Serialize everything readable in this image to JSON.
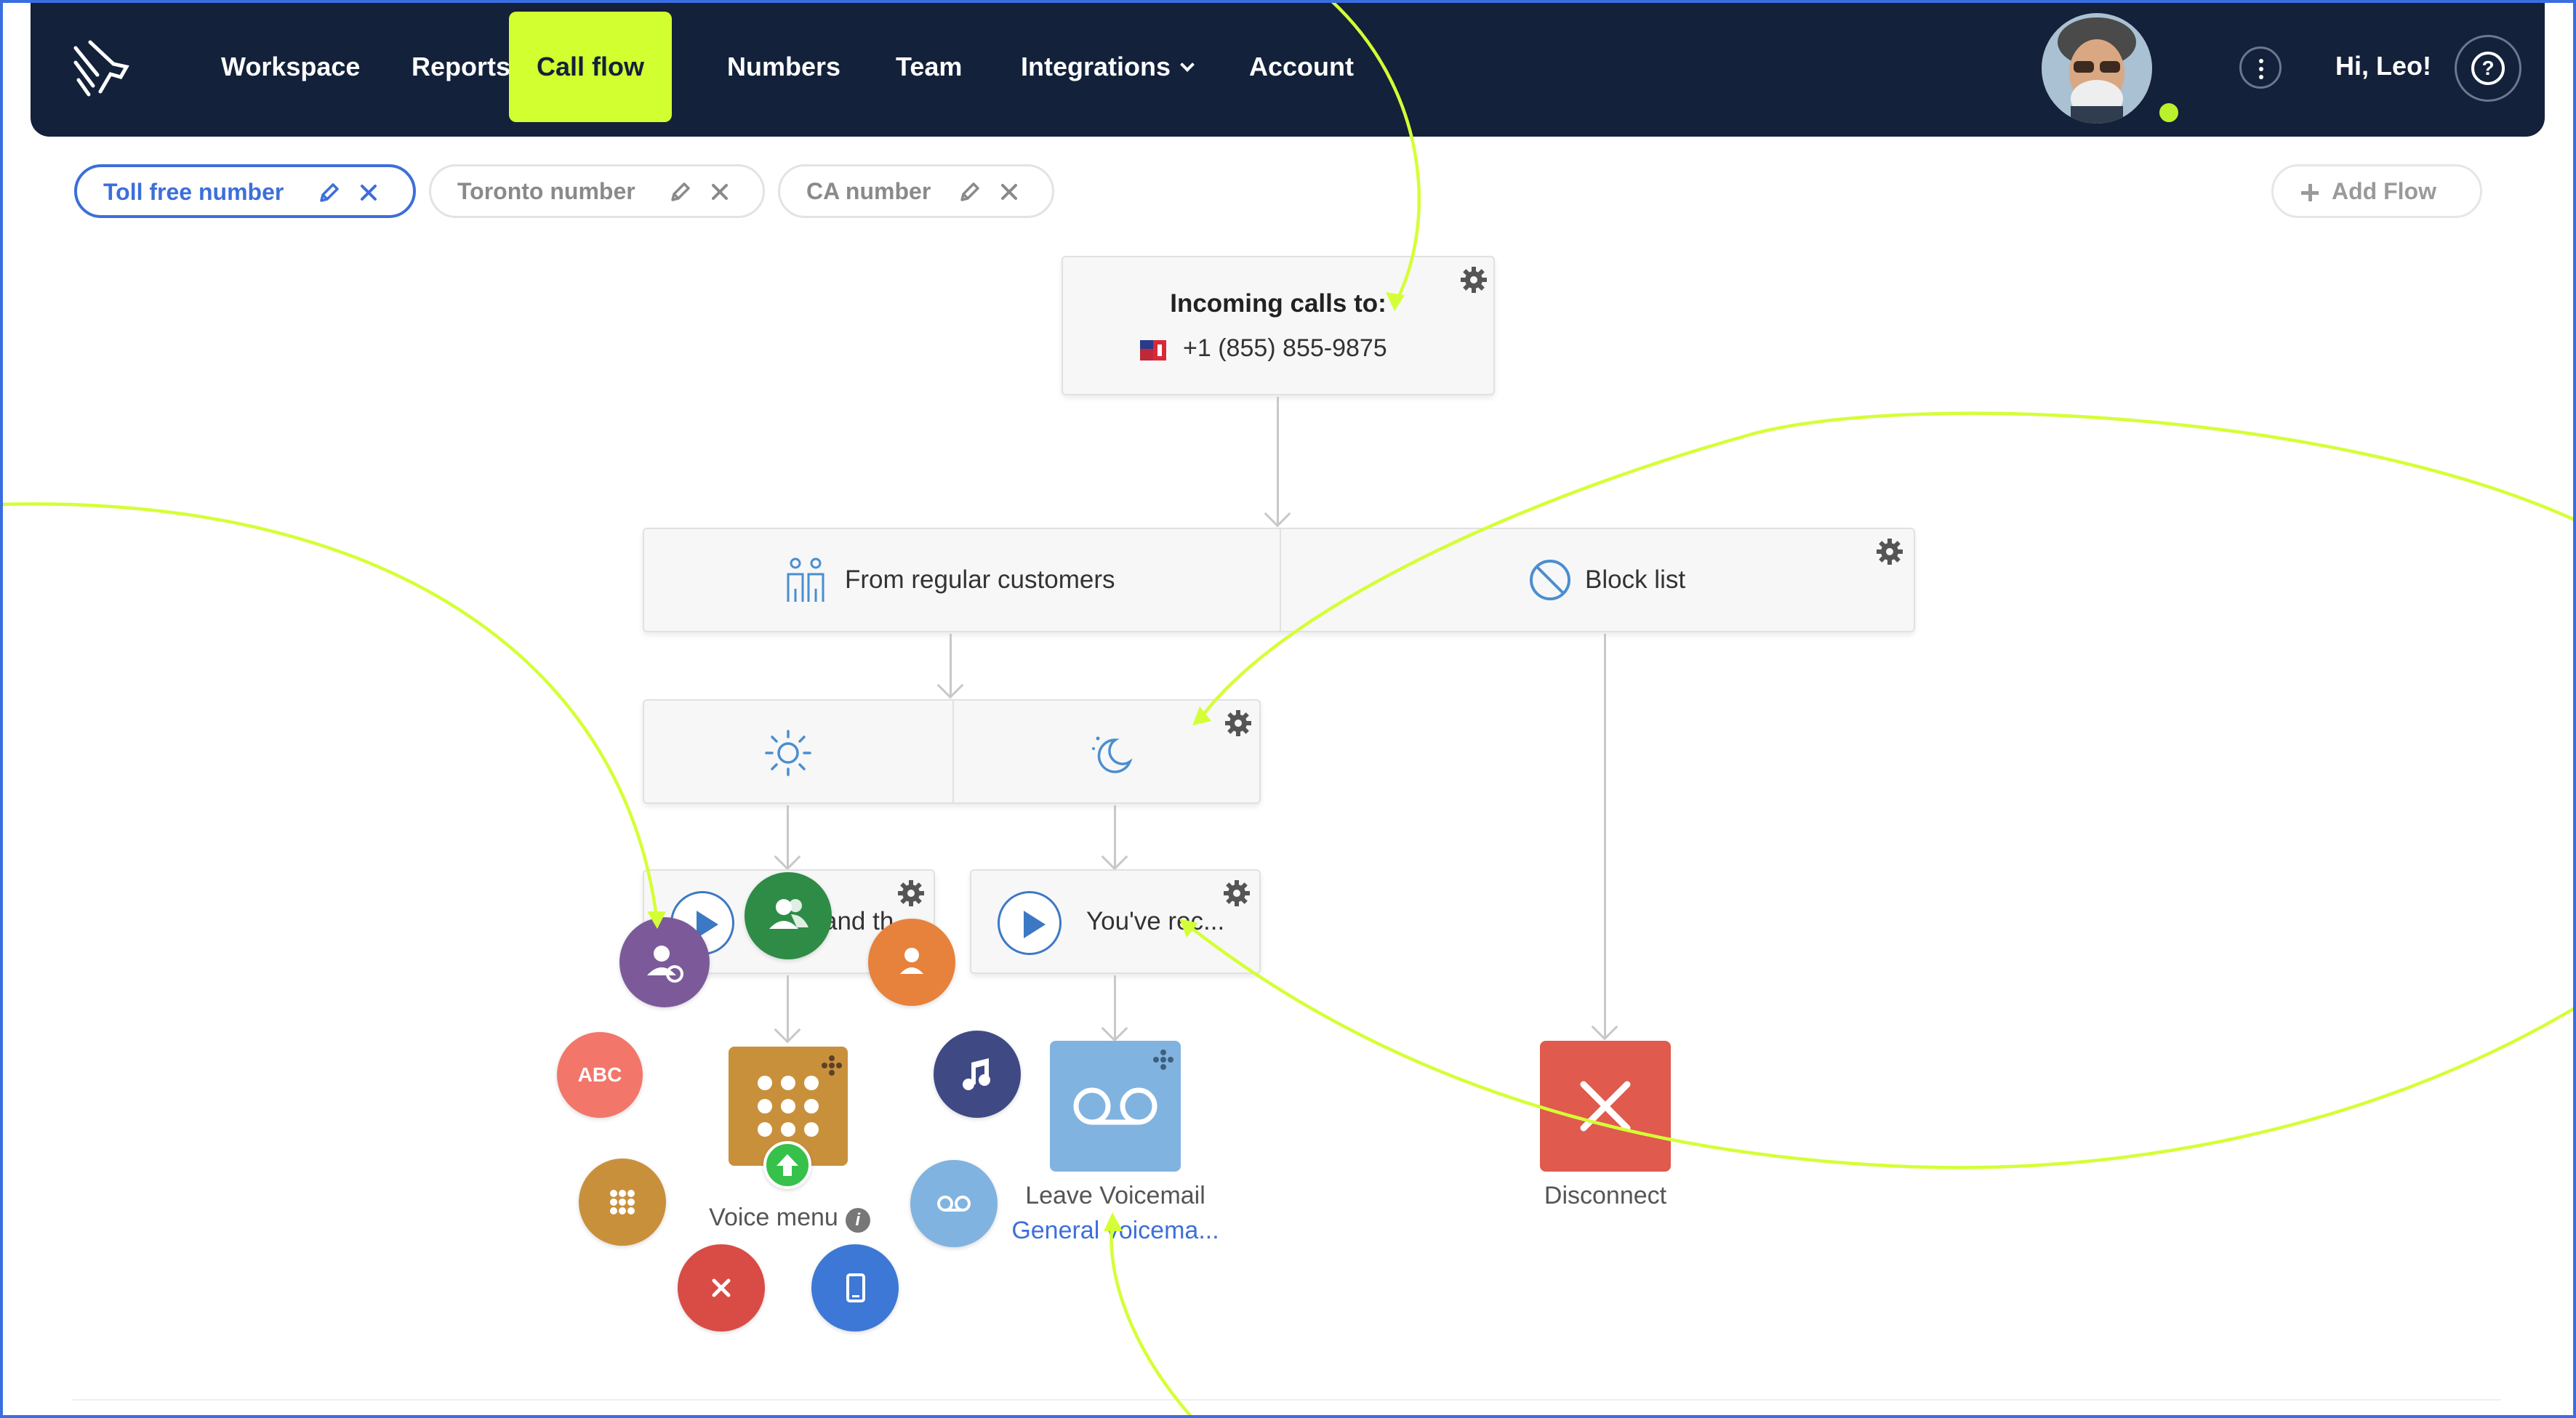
{
  "nav": {
    "items": [
      {
        "label": "Workspace"
      },
      {
        "label": "Reports"
      },
      {
        "label": "Call flow",
        "active": true
      },
      {
        "label": "Numbers"
      },
      {
        "label": "Team"
      },
      {
        "label": "Integrations",
        "has_dropdown": true
      },
      {
        "label": "Account"
      }
    ],
    "greeting": "Hi, Leo!",
    "help_glyph": "?",
    "status": "online"
  },
  "tabs": [
    {
      "label": "Toll free number",
      "active": true
    },
    {
      "label": "Toronto number"
    },
    {
      "label": "CA number"
    }
  ],
  "add_flow_label": "Add Flow",
  "flow": {
    "incoming": {
      "title": "Incoming calls to:",
      "number": "+1 (855) 855-9875",
      "flag": "us-ca-flag-icon"
    },
    "segments": {
      "regular": "From regular customers",
      "block": "Block list"
    },
    "hours": {
      "day_icon": "sun-icon",
      "night_icon": "moon-icon"
    },
    "greeting_day": "and th",
    "greeting_night": "You've rec...",
    "voice_menu": {
      "label": "Voice menu",
      "info": "i"
    },
    "voicemail": {
      "label": "Leave Voicemail",
      "link": "General voicema..."
    },
    "disconnect": {
      "label": "Disconnect"
    },
    "bubbles": {
      "abc": "ABC"
    }
  },
  "colors": {
    "nav_bg": "#13213a",
    "accent": "#d2ff30",
    "tab_active": "#3d6fd9",
    "voicemail": "#80b3e0",
    "disconnect": "#e05a4e",
    "voice_menu": "#c9903c",
    "arrows": "#d4ff36"
  }
}
